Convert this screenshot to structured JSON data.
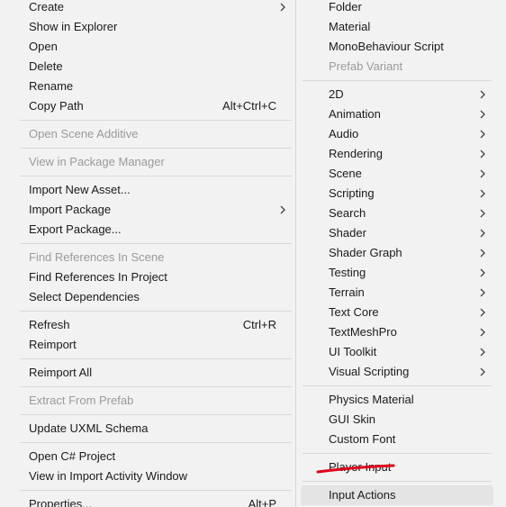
{
  "context_menu": {
    "items": [
      {
        "label": "Create",
        "has_submenu": true,
        "disabled": false
      },
      {
        "label": "Show in Explorer",
        "disabled": false
      },
      {
        "label": "Open",
        "disabled": false
      },
      {
        "label": "Delete",
        "disabled": false
      },
      {
        "label": "Rename",
        "disabled": false
      },
      {
        "label": "Copy Path",
        "shortcut": "Alt+Ctrl+C",
        "disabled": false
      },
      {
        "label": "Open Scene Additive",
        "disabled": true
      },
      {
        "label": "View in Package Manager",
        "disabled": true
      },
      {
        "label": "Import New Asset...",
        "disabled": false
      },
      {
        "label": "Import Package",
        "has_submenu": true,
        "disabled": false
      },
      {
        "label": "Export Package...",
        "disabled": false
      },
      {
        "label": "Find References In Scene",
        "disabled": true
      },
      {
        "label": "Find References In Project",
        "disabled": false
      },
      {
        "label": "Select Dependencies",
        "disabled": false
      },
      {
        "label": "Refresh",
        "shortcut": "Ctrl+R",
        "disabled": false
      },
      {
        "label": "Reimport",
        "disabled": false
      },
      {
        "label": "Reimport All",
        "disabled": false
      },
      {
        "label": "Extract From Prefab",
        "disabled": true
      },
      {
        "label": "Update UXML Schema",
        "disabled": false
      },
      {
        "label": "Open C# Project",
        "disabled": false
      },
      {
        "label": "View in Import Activity Window",
        "disabled": false
      },
      {
        "label": "Properties...",
        "shortcut": "Alt+P",
        "disabled": false
      }
    ]
  },
  "create_submenu": {
    "items": [
      {
        "label": "Folder",
        "disabled": false
      },
      {
        "label": "Material",
        "disabled": false
      },
      {
        "label": "MonoBehaviour Script",
        "disabled": false
      },
      {
        "label": "Prefab Variant",
        "disabled": true
      },
      {
        "label": "2D",
        "has_submenu": true
      },
      {
        "label": "Animation",
        "has_submenu": true
      },
      {
        "label": "Audio",
        "has_submenu": true
      },
      {
        "label": "Rendering",
        "has_submenu": true
      },
      {
        "label": "Scene",
        "has_submenu": true
      },
      {
        "label": "Scripting",
        "has_submenu": true
      },
      {
        "label": "Search",
        "has_submenu": true
      },
      {
        "label": "Shader",
        "has_submenu": true
      },
      {
        "label": "Shader Graph",
        "has_submenu": true
      },
      {
        "label": "Testing",
        "has_submenu": true
      },
      {
        "label": "Terrain",
        "has_submenu": true
      },
      {
        "label": "Text Core",
        "has_submenu": true
      },
      {
        "label": "TextMeshPro",
        "has_submenu": true
      },
      {
        "label": "UI Toolkit",
        "has_submenu": true
      },
      {
        "label": "Visual Scripting",
        "has_submenu": true
      },
      {
        "label": "Physics Material",
        "disabled": false
      },
      {
        "label": "GUI Skin",
        "disabled": false
      },
      {
        "label": "Custom Font",
        "disabled": false
      },
      {
        "label": "Player Input",
        "disabled": false,
        "annotated": true
      },
      {
        "label": "Input Actions",
        "disabled": false,
        "hovered": true
      }
    ]
  },
  "colors": {
    "menu_background": "#f2f2f2",
    "hover_background": "#e4e4e4",
    "disabled_text": "#9a9a9a",
    "annotation_underline": "#e0001b"
  }
}
